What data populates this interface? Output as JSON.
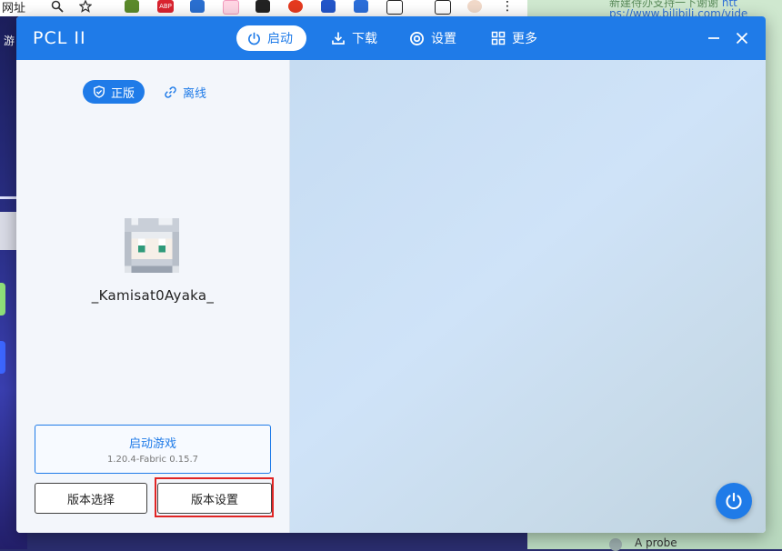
{
  "browser": {
    "address_label": "网址",
    "left_side_label": "游"
  },
  "background_right": {
    "caption_line1": "新建待办支持一下谢谢",
    "caption_link1": "htt",
    "caption_line2": "ps://www.bilibili.com/vide",
    "probe_text": "A probe"
  },
  "window": {
    "title": "PCL II",
    "nav": [
      {
        "label": "启动",
        "icon": "power-icon",
        "active": true
      },
      {
        "label": "下载",
        "icon": "download-icon",
        "active": false
      },
      {
        "label": "设置",
        "icon": "gear-icon",
        "active": false
      },
      {
        "label": "更多",
        "icon": "grid-icon",
        "active": false
      }
    ]
  },
  "sidebar": {
    "login_tabs": [
      {
        "label": "正版",
        "icon": "shield-check-icon",
        "active": true
      },
      {
        "label": "离线",
        "icon": "link-icon",
        "active": false
      }
    ],
    "username": "_Kamisat0Ayaka_",
    "launch_button": {
      "label": "启动游戏",
      "version": "1.20.4-Fabric 0.15.7"
    },
    "version_select_label": "版本选择",
    "version_settings_label": "版本设置"
  },
  "colors": {
    "accent": "#1f7be8",
    "highlight": "#e02424"
  }
}
